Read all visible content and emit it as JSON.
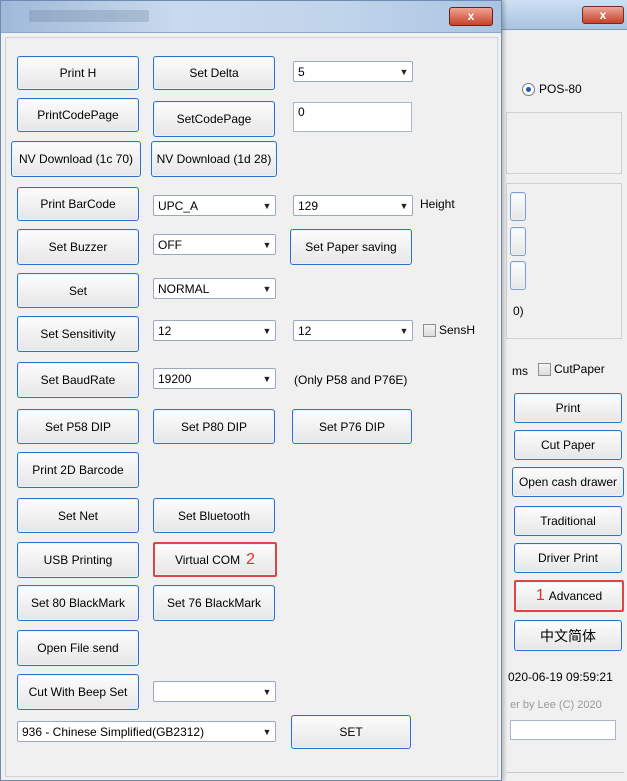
{
  "back_window": {
    "close_label": "x",
    "radio_label": "POS-80",
    "partial_text": "0)",
    "ms_label": "ms",
    "cutpaper_label": "CutPaper",
    "buttons": {
      "print": "Print",
      "cut_paper": "Cut Paper",
      "open_cash_drawer": "Open cash drawer",
      "traditional": "Traditional",
      "driver_print": "Driver Print",
      "advanced": "Advanced",
      "chinese_simplified": "中文简体"
    },
    "advanced_marker": "1",
    "datetime": "020-06-19 09:59:21",
    "credit": "er by Lee (C) 2020"
  },
  "front_window": {
    "close_label": "x",
    "buttons": {
      "print_h": "Print H",
      "set_delta": "Set Delta",
      "print_code_page": "PrintCodePage",
      "set_code_page": "SetCodePage",
      "nv_download_1c70": "NV Download (1c 70)",
      "nv_download_1d28": "NV Download (1d 28)",
      "print_barcode": "Print BarCode",
      "set_buzzer": "Set Buzzer",
      "set_paper_saving": "Set Paper saving",
      "set": "Set",
      "set_sensitivity": "Set Sensitivity",
      "set_baudrate": "Set BaudRate",
      "set_p58_dip": "Set P58 DIP",
      "set_p80_dip": "Set P80 DIP",
      "set_p76_dip": "Set P76 DIP",
      "print_2d_barcode": "Print 2D Barcode",
      "set_net": "Set Net",
      "set_bluetooth": "Set Bluetooth",
      "usb_printing": "USB Printing",
      "virtual_com": "Virtual COM",
      "set_80_blackmark": "Set 80 BlackMark",
      "set_76_blackmark": "Set 76 BlackMark",
      "open_file_send": "Open File send",
      "cut_with_beep_set": "Cut With Beep Set",
      "set_final": "SET"
    },
    "virtual_com_marker": "2",
    "combos": {
      "delta": "5",
      "barcode_type": "UPC_A",
      "barcode_height": "129",
      "buzzer": "OFF",
      "mode": "NORMAL",
      "sensitivity_1": "12",
      "sensitivity_2": "12",
      "baudrate": "19200",
      "cut_beep": "",
      "codepage": "936 - Chinese Simplified(GB2312)"
    },
    "codepage_value": "0",
    "height_label": "Height",
    "sensh_label": "SensH",
    "baud_note": "(Only P58 and P76E)"
  }
}
